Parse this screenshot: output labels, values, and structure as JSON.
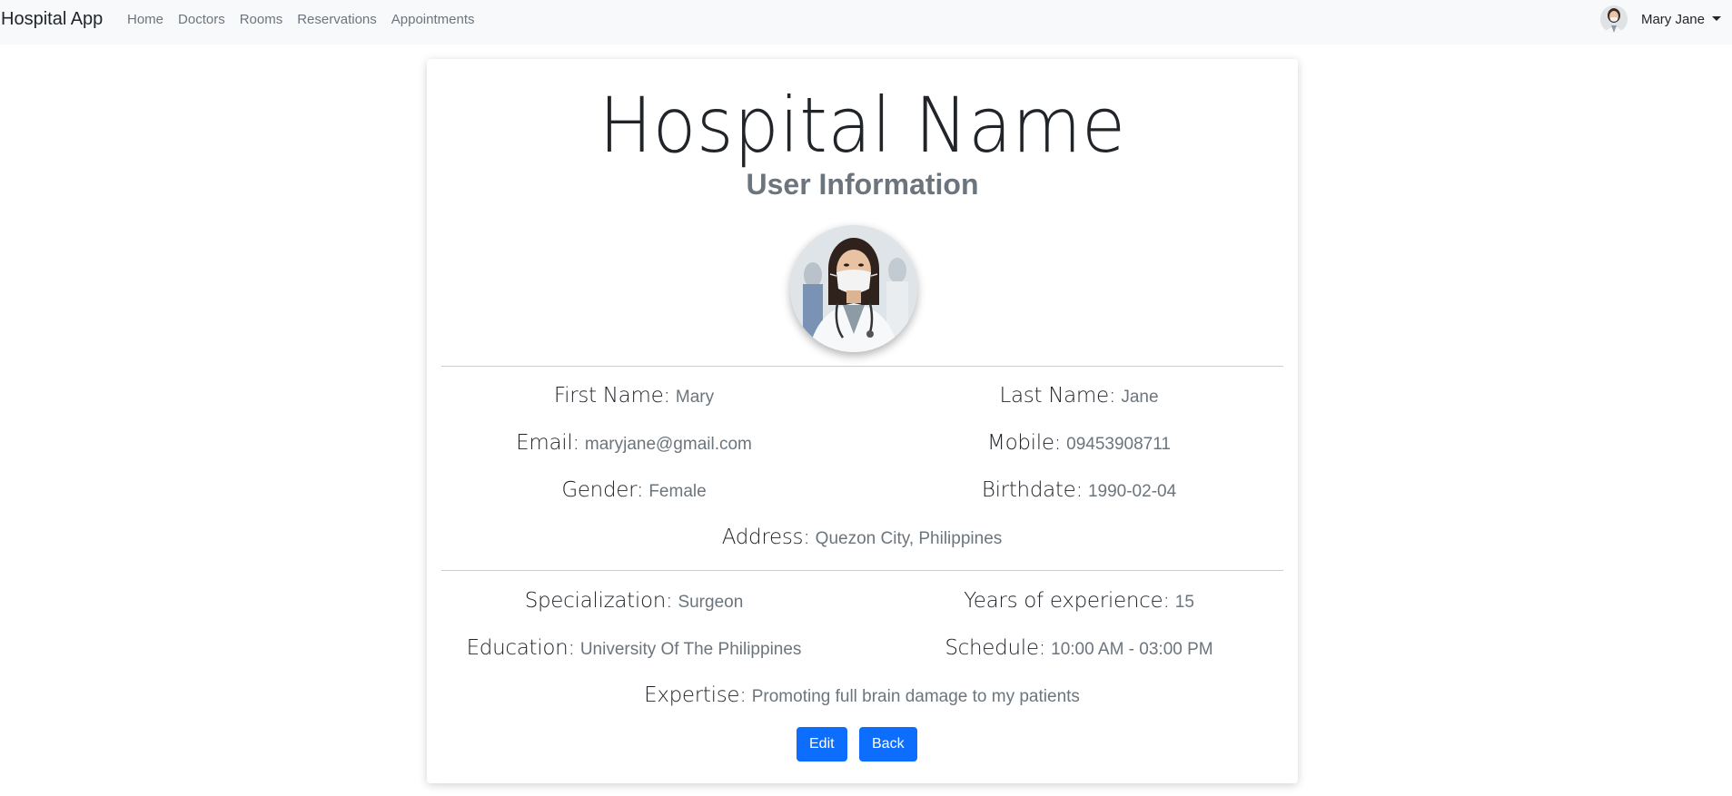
{
  "navbar": {
    "brand": "Hospital App",
    "links": [
      "Home",
      "Doctors",
      "Rooms",
      "Reservations",
      "Appointments"
    ],
    "user_name": "Mary Jane"
  },
  "card": {
    "hospital_name": "Hospital Name",
    "section_title": "User Information",
    "personal": {
      "first_name": {
        "label": "First Name:",
        "value": "Mary"
      },
      "last_name": {
        "label": "Last Name:",
        "value": "Jane"
      },
      "email": {
        "label": "Email:",
        "value": "maryjane@gmail.com"
      },
      "mobile": {
        "label": "Mobile:",
        "value": "09453908711"
      },
      "gender": {
        "label": "Gender:",
        "value": "Female"
      },
      "birthdate": {
        "label": "Birthdate:",
        "value": "1990-02-04"
      },
      "address": {
        "label": "Address:",
        "value": "Quezon City, Philippines"
      }
    },
    "professional": {
      "specialization": {
        "label": "Specialization:",
        "value": "Surgeon"
      },
      "years_experience": {
        "label": "Years of experience:",
        "value": "15"
      },
      "education": {
        "label": "Education:",
        "value": "University Of The Philippines"
      },
      "schedule": {
        "label": "Schedule:",
        "value": "10:00 AM - 03:00 PM"
      },
      "expertise": {
        "label": "Expertise:",
        "value": "Promoting full brain damage to my patients"
      }
    },
    "buttons": {
      "edit": "Edit",
      "back": "Back"
    }
  },
  "colors": {
    "primary": "#0d6efd",
    "navbar_bg": "#f8f9fa",
    "muted": "#6c757d"
  }
}
